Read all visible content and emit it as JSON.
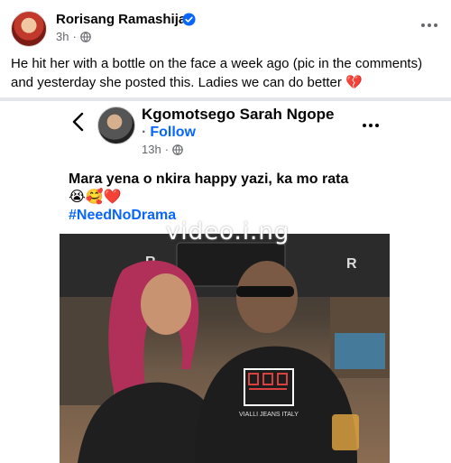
{
  "post": {
    "author": "Rorisang Ramashija",
    "time": "3h",
    "caption": "He hit her with a bottle on the face a week ago (pic in the comments) and yesterday she posted this. Ladies we can do better 💔"
  },
  "shared_post": {
    "author": "Kgomotsego Sarah Ngope",
    "follow_label": "Follow",
    "time": "13h",
    "caption": "Mara yena o nkira happy yazi, ka mo rata",
    "emojis": "😭🥰❤️",
    "hashtag": "#NeedNoDrama",
    "watermark": "video.i.ng"
  },
  "photo": {
    "sign_left": "R",
    "sign_right": "R",
    "shirt_text": "VIALLI JEANS ITALY"
  },
  "colors": {
    "link_blue": "#0866ff",
    "meta_gray": "#65676b",
    "verified_blue": "#0866ff"
  },
  "icons": [
    "verified-badge-icon",
    "globe-icon",
    "more-options-icon",
    "back-arrow-icon"
  ]
}
